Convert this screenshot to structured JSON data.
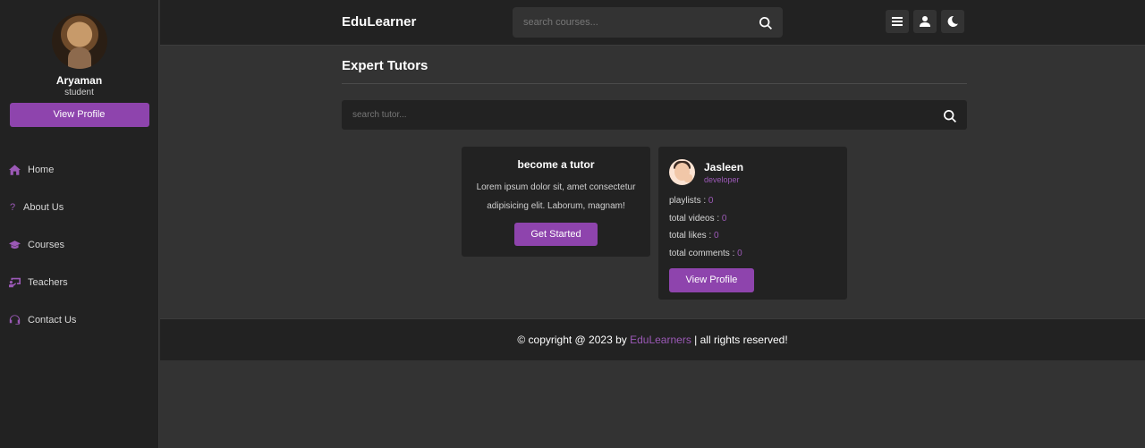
{
  "header": {
    "brand": "EduLearner",
    "search_placeholder": "search courses...",
    "buttons": [
      "menu-icon",
      "user-icon",
      "moon-icon"
    ]
  },
  "sidebar": {
    "user_name": "Aryaman",
    "user_role": "student",
    "view_profile_label": "View Profile",
    "items": [
      {
        "label": "Home",
        "icon": "home-icon"
      },
      {
        "label": "About Us",
        "icon": "question-icon"
      },
      {
        "label": "Courses",
        "icon": "graduation-cap-icon"
      },
      {
        "label": "Teachers",
        "icon": "chalkboard-teacher-icon"
      },
      {
        "label": "Contact Us",
        "icon": "headset-icon"
      }
    ]
  },
  "main": {
    "heading": "Expert Tutors",
    "tutor_search_placeholder": "search tutor...",
    "become_card": {
      "title": "become a tutor",
      "text": "Lorem ipsum dolor sit, amet consectetur adipisicing elit. Laborum, magnam!",
      "button": "Get Started"
    },
    "tutor_card": {
      "name": "Jasleen",
      "role": "developer",
      "stats": [
        {
          "label": "playlists : ",
          "value": "0"
        },
        {
          "label": "total videos : ",
          "value": "0"
        },
        {
          "label": "total likes : ",
          "value": "0"
        },
        {
          "label": "total comments : ",
          "value": "0"
        }
      ],
      "button": "View Profile"
    }
  },
  "footer": {
    "prefix": "© copyright @ 2023 by ",
    "brand": "EduLearners",
    "suffix": " | all rights reserved!"
  },
  "colors": {
    "accent": "#8e44ad",
    "accent_text": "#9b59b6",
    "panel": "#222222",
    "background": "#333333"
  }
}
